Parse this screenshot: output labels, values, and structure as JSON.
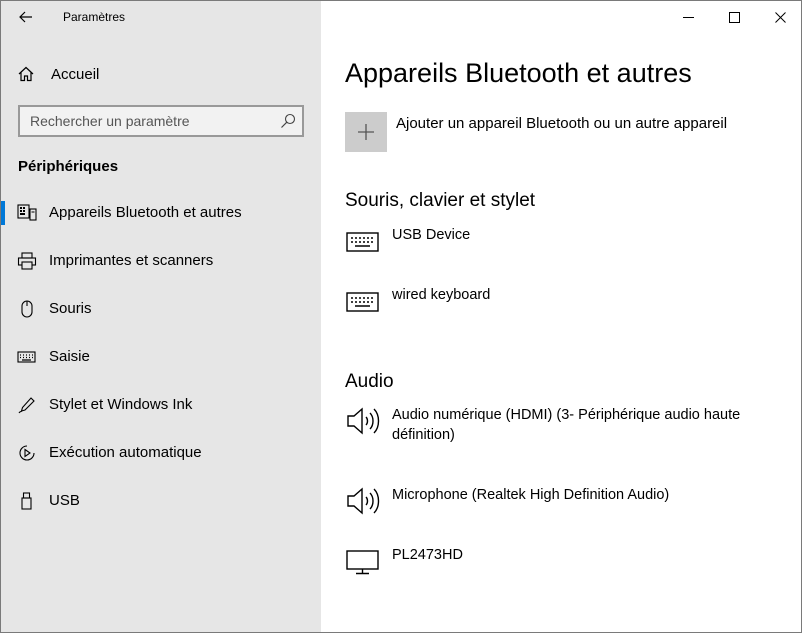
{
  "window": {
    "title": "Paramètres",
    "controls": [
      "minimize-icon",
      "maximize-icon",
      "close-icon"
    ]
  },
  "sidebar": {
    "home_label": "Accueil",
    "search_placeholder": "Rechercher un paramètre",
    "section_title": "Périphériques",
    "items": [
      {
        "label": "Appareils Bluetooth et autres",
        "icon": "bluetooth-devices-icon",
        "active": true
      },
      {
        "label": "Imprimantes et scanners",
        "icon": "printer-icon",
        "active": false
      },
      {
        "label": "Souris",
        "icon": "mouse-icon",
        "active": false
      },
      {
        "label": "Saisie",
        "icon": "keyboard-icon",
        "active": false
      },
      {
        "label": "Stylet et Windows Ink",
        "icon": "pen-icon",
        "active": false
      },
      {
        "label": "Exécution automatique",
        "icon": "autoplay-icon",
        "active": false
      },
      {
        "label": "USB",
        "icon": "usb-icon",
        "active": false
      }
    ]
  },
  "main": {
    "title": "Appareils Bluetooth et autres",
    "add_device_label": "Ajouter un appareil Bluetooth ou un autre appareil",
    "groups": [
      {
        "title": "Souris, clavier et stylet",
        "devices": [
          {
            "name": "USB Device",
            "icon": "keyboard-icon"
          },
          {
            "name": "wired keyboard",
            "icon": "keyboard-icon"
          }
        ]
      },
      {
        "title": "Audio",
        "devices": [
          {
            "name": "Audio numérique (HDMI) (3- Périphérique audio haute définition)",
            "icon": "speaker-icon"
          },
          {
            "name": "Microphone (Realtek High Definition Audio)",
            "icon": "speaker-icon"
          },
          {
            "name": "PL2473HD",
            "icon": "monitor-icon"
          }
        ]
      }
    ]
  },
  "colors": {
    "sidebar_bg": "#e6e6e6",
    "accent": "#0078d7",
    "add_button_bg": "#cccccc"
  }
}
